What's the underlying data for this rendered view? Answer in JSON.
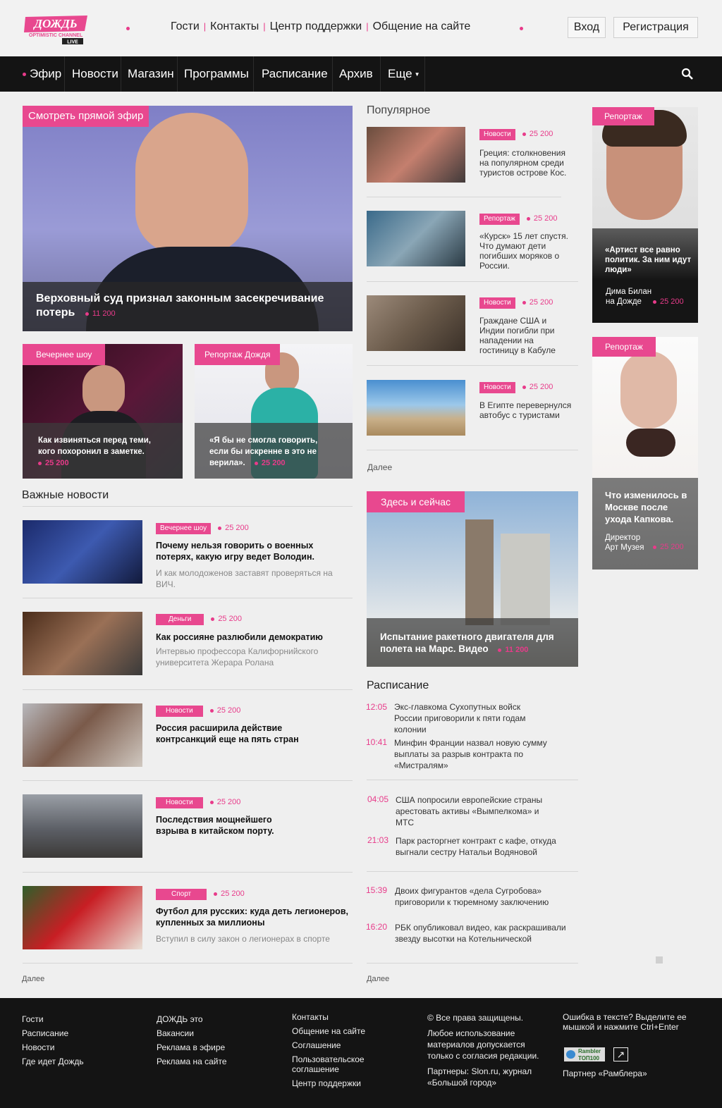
{
  "logo": {
    "main": "ДОЖДЬ",
    "sub": "OPTIMISTIC CHANNEL",
    "live": "LIVE"
  },
  "topnav": [
    "Гости",
    "Контакты",
    "Центр поддержки",
    "Общение на сайте"
  ],
  "auth": {
    "login": "Вход",
    "register": "Регистрация"
  },
  "nav": [
    "Эфир",
    "Новости",
    "Магазин",
    "Программы",
    "Расписание",
    "Архив",
    "Еще"
  ],
  "hero": {
    "tag": "Смотреть прямой эфир",
    "title": "Верховный суд признал законным засекречивание потерь",
    "views": "11 200"
  },
  "small_cards": [
    {
      "tag": "Вечернее шоу",
      "title": "Как извиняться перед теми, кого похоронил в заметке.",
      "views": "25 200"
    },
    {
      "tag": "Репортаж Дождя",
      "title": "«Я бы не смогла говорить, если бы искренне в это не верила».",
      "views": "25 200"
    }
  ],
  "important": {
    "heading": "Важные новости",
    "items": [
      {
        "badge": "Вечернее шоу",
        "views": "25 200",
        "title": "Почему нельзя говорить о военных потерях, какую игру ведет Володин.",
        "sub": "И как молодоженов заставят проверяться на ВИЧ."
      },
      {
        "badge": "Деньги",
        "views": "25 200",
        "title": "Как россияне разлюбили демократию",
        "sub": "Интервью профессора Калифорнийского университета Жерара Ролана"
      },
      {
        "badge": "Новости",
        "views": "25 200",
        "title": "Россия расширила действие контрсанкций еще на пять стран",
        "sub": ""
      },
      {
        "badge": "Новости",
        "views": "25 200",
        "title": "Последствия мощнейшего взрыва в китайском порту.",
        "sub": ""
      },
      {
        "badge": "Спорт",
        "views": "25 200",
        "title": "Футбол для русских: куда деть легионеров, купленных за миллионы",
        "sub": "Вступил в силу закон о легионерах в спорте"
      }
    ],
    "more": "Далее"
  },
  "popular": {
    "heading": "Популярное",
    "items": [
      {
        "badge": "Новости",
        "views": "25 200",
        "text": "Греция: столкновения на популярном среди туристов острове Кос."
      },
      {
        "badge": "Репортаж",
        "views": "25 200",
        "text": "«Курск» 15 лет спустя. Что думают дети погибших моряков о России."
      },
      {
        "badge": "Новости",
        "views": "25 200",
        "text": "Граждане США и Индии погибли при нападении на гостиницу в Кабуле"
      },
      {
        "badge": "Новости",
        "views": "25 200",
        "text": "В Египте перевернулся автобус с туристами"
      }
    ],
    "more": "Далее"
  },
  "here_now": {
    "tag": "Здесь и сейчас",
    "title": "Испытание ракетного двигателя для полета на Марс. Видео",
    "views": "11 200"
  },
  "schedule": {
    "heading": "Расписание",
    "items": [
      {
        "time": "12:05",
        "text": "Экс-главкома Сухопутных войск России приговорили к пяти годам колонии"
      },
      {
        "time": "10:41",
        "text": "Минфин Франции назвал новую сумму выплаты за разрыв контракта по «Мистралям»"
      },
      {
        "time": "04:05",
        "text": "США попросили европейские страны арестовать активы «Вымпелкома» и МТС"
      },
      {
        "time": "21:03",
        "text": "Парк расторгнет контракт с кафе, откуда выгнали сестру Натальи Водяновой"
      },
      {
        "time": "15:39",
        "text": "Двоих фигурантов «дела Сугробова» приговорили к тюремному заключению"
      },
      {
        "time": "16:20",
        "text": "РБК опубликовал видео, как раскрашивали звезду высотки на Котельнической"
      }
    ],
    "more": "Далее"
  },
  "side_cards": [
    {
      "tag": "Репортаж",
      "title": "«Артист все равно политик. За ним идут люди»",
      "person": "Дима Билан на Дожде",
      "views": "25 200"
    },
    {
      "tag": "Репортаж",
      "title": "Что изменилось в Москве после ухода Капкова.",
      "person": "Директор Арт Музея",
      "views": "25 200"
    }
  ],
  "footer": {
    "col1": [
      "Гости",
      "Расписание",
      "Новости",
      "Где идет Дождь"
    ],
    "col2": [
      "ДОЖДЬ это",
      "Вакансии",
      "Реклама в эфире",
      "Реклама на сайте"
    ],
    "col3": [
      "Контакты",
      "Общение на сайте",
      "Соглашение",
      "Пользовательское соглашение",
      "Центр поддержки"
    ],
    "copyright": "© Все права защищены.",
    "usage": "Любое использование материалов допускается только с согласия редакции.",
    "partners": "Партнеры: Slon.ru, журнал «Большой город»",
    "typo": "Ошибка в тексте? Выделите ее мышкой и нажмите Ctrl+Enter",
    "rambler_badge": "Rambler ТОП100",
    "rambler_partner": "Партнер «Рамблера»"
  },
  "colors": {
    "accent": "#e8488f",
    "nav_bg": "#141414",
    "page_bg": "#efefef"
  }
}
